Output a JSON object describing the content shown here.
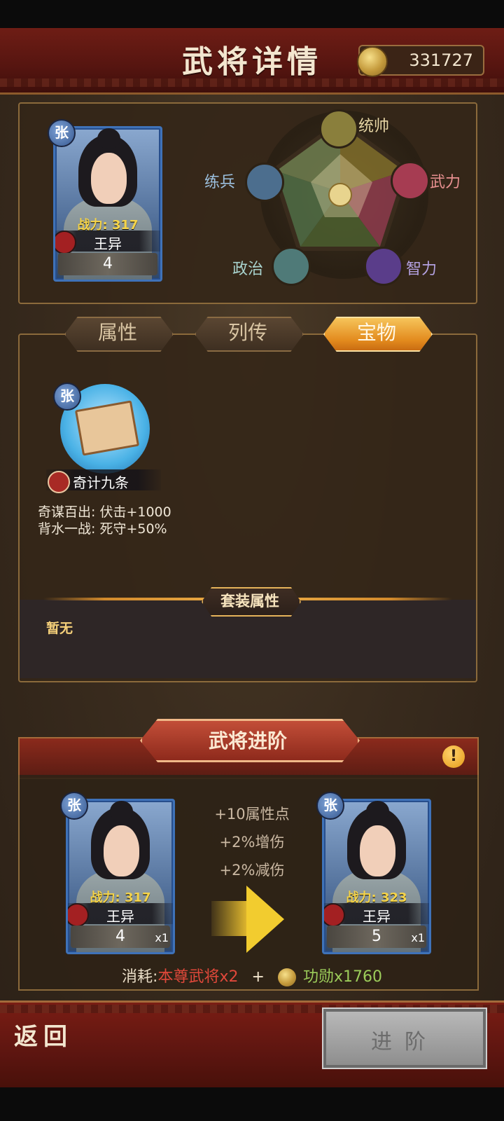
{
  "header": {
    "title": "武将详情",
    "currency_value": "331727"
  },
  "general": {
    "rarity_badge": "张",
    "power_label": "战力:",
    "power_value": "317",
    "name": "王异",
    "level": "4"
  },
  "stats": {
    "command": "统帅",
    "force": "武力",
    "intelligence": "智力",
    "politics": "政治",
    "training": "练兵"
  },
  "tabs": [
    {
      "label": "属性",
      "active": false
    },
    {
      "label": "列传",
      "active": false
    },
    {
      "label": "宝物",
      "active": true
    }
  ],
  "treasure": {
    "badge": "张",
    "name": "奇计九条",
    "effects": [
      "奇谋百出: 伏击+1000",
      "背水一战: 死守+50%"
    ]
  },
  "set": {
    "title": "套装属性",
    "value": "暂无"
  },
  "advance": {
    "title": "武将进阶",
    "bonuses": [
      "+10属性点",
      "+2%增伤",
      "+2%减伤"
    ],
    "from": {
      "badge": "张",
      "power_label": "战力:",
      "power_value": "317",
      "name": "王异",
      "level": "4",
      "count": "x1"
    },
    "to": {
      "badge": "张",
      "power_label": "战力:",
      "power_value": "323",
      "name": "王异",
      "level": "5",
      "count": "x1"
    },
    "cost_label": "消耗:",
    "cost_item": "本尊武将x2",
    "cost_plus": "+",
    "cost_merit": "功勋x1760"
  },
  "footer": {
    "back": "返回",
    "advance_button": "进阶"
  },
  "colors": {
    "accent_gold": "#f0b24a",
    "cost_red": "#e0483a",
    "cost_green": "#9ccc5a",
    "power_yellow": "#f5d44a"
  }
}
